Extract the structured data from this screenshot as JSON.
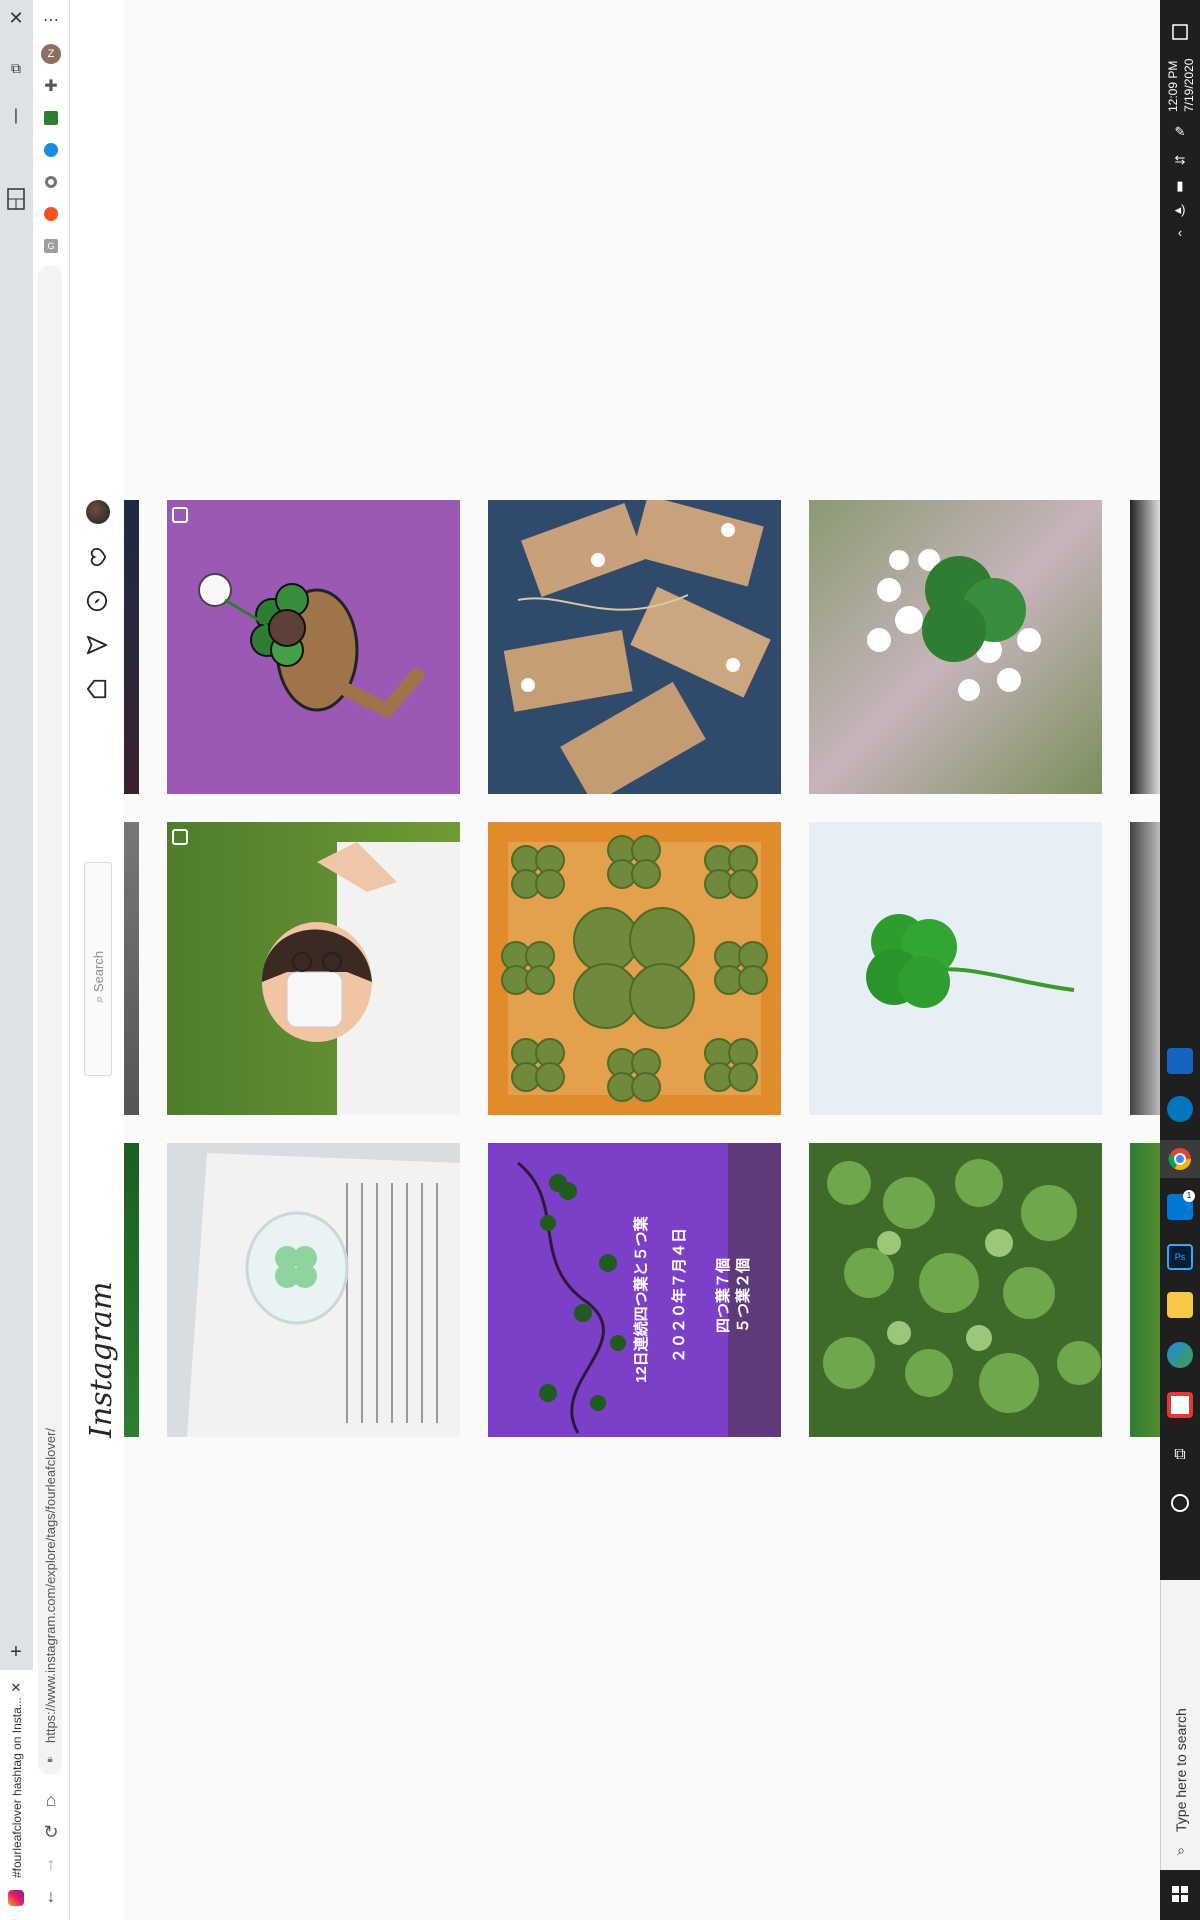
{
  "browser": {
    "tab_title": "#fourleafclover hashtag on Insta...",
    "address": "https://www.instagram.com/explore/tags/fourleafclover/",
    "profile_initial": "Z"
  },
  "instagram": {
    "logo": "Instagram",
    "search_placeholder": "Search"
  },
  "taskbar": {
    "time": "12:09 PM",
    "date": "7/19/2020",
    "search_placeholder": "Type here to search",
    "outlook_badge": "1"
  },
  "posts": [
    {
      "id": "purple-clover-character",
      "multi": true
    },
    {
      "id": "kraft-gift-tags"
    },
    {
      "id": "white-flower-clover"
    },
    {
      "id": "masked-person-grass",
      "multi": true
    },
    {
      "id": "origami-clovers"
    },
    {
      "id": "single-four-leaf-clover"
    },
    {
      "id": "resin-clover-book"
    },
    {
      "id": "notebook-clovers-japanese",
      "text_lines": [
        "12日連続四つ葉と５つ葉",
        "２０２０年７月４日",
        "四つ葉７個",
        "５つ葉２個"
      ]
    },
    {
      "id": "clover-patch"
    }
  ],
  "colors": {
    "instagram_bg": "#fafafa",
    "taskbar": "#1f1f1f",
    "tile_purple": "#9b59b6"
  }
}
